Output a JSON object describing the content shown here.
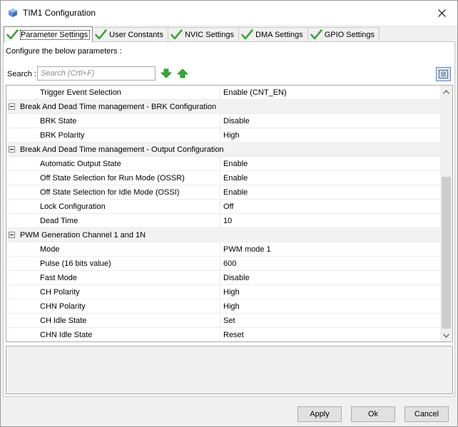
{
  "window": {
    "title": "TIM1 Configuration"
  },
  "tabs": [
    {
      "label": "Parameter Settings",
      "active": true
    },
    {
      "label": "User Constants",
      "active": false
    },
    {
      "label": "NVIC Settings",
      "active": false
    },
    {
      "label": "DMA Settings",
      "active": false
    },
    {
      "label": "GPIO Settings",
      "active": false
    }
  ],
  "panel": {
    "configure_label": "Configure the below parameters :"
  },
  "search": {
    "label": "Search :",
    "placeholder": "Search (Crtl+F)"
  },
  "parameters": [
    {
      "type": "param",
      "name": "Trigger Event Selection",
      "value": "Enable (CNT_EN)"
    },
    {
      "type": "group",
      "name": "Break And Dead Time management - BRK Configuration"
    },
    {
      "type": "param",
      "name": "BRK State",
      "value": "Disable"
    },
    {
      "type": "param",
      "name": "BRK Polarity",
      "value": "High"
    },
    {
      "type": "group",
      "name": "Break And Dead Time management - Output Configuration"
    },
    {
      "type": "param",
      "name": "Automatic Output State",
      "value": "Enable"
    },
    {
      "type": "param",
      "name": "Off State Selection for Run Mode (OSSR)",
      "value": "Enable"
    },
    {
      "type": "param",
      "name": "Off State Selection for Idle Mode (OSSI)",
      "value": "Enable"
    },
    {
      "type": "param",
      "name": "Lock Configuration",
      "value": "Off"
    },
    {
      "type": "param",
      "name": "Dead Time",
      "value": "10"
    },
    {
      "type": "group",
      "name": "PWM Generation Channel 1 and 1N"
    },
    {
      "type": "param",
      "name": "Mode",
      "value": "PWM mode 1"
    },
    {
      "type": "param",
      "name": "Pulse (16 bits value)",
      "value": "600"
    },
    {
      "type": "param",
      "name": "Fast Mode",
      "value": "Disable"
    },
    {
      "type": "param",
      "name": "CH Polarity",
      "value": "High"
    },
    {
      "type": "param",
      "name": "CHN Polarity",
      "value": "High"
    },
    {
      "type": "param",
      "name": "CH Idle State",
      "value": "Set"
    },
    {
      "type": "param",
      "name": "CHN Idle State",
      "value": "Reset"
    }
  ],
  "buttons": {
    "apply": "Apply",
    "ok": "Ok",
    "cancel": "Cancel"
  },
  "colors": {
    "check_green": "#3aa53a",
    "arrow_green": "#2eae2e",
    "view_button_blue": "#5c86c0"
  }
}
